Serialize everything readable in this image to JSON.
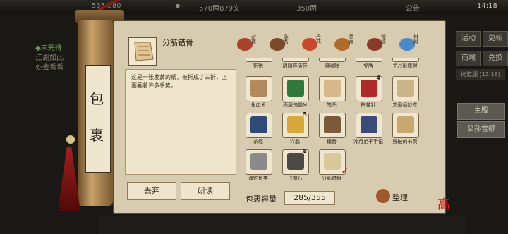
{
  "hud": {
    "resource1": "535/280",
    "currency": "570两879文",
    "gold": "350两",
    "announcement": "公告",
    "clock": "14:18"
  },
  "quest": {
    "header": "未完待",
    "line2": "江湖如此",
    "line3": "处去看看"
  },
  "right_menu": {
    "btn1": "活动",
    "btn2": "更新",
    "btn3": "商城",
    "btn4": "兑换",
    "label": "拘道服 (13:16)",
    "btn5": "主殿",
    "btn6": "公孙雪柳"
  },
  "scroll": {
    "label_top": "包",
    "label_bottom": "裹"
  },
  "selected_item": {
    "name": "分筋错骨",
    "description": "这是一张发黄的纸，被折成了三折，上面画着许多手势。"
  },
  "actions": {
    "discard": "丢弃",
    "study": "研读"
  },
  "categories": [
    {
      "label": "杂项",
      "color": "#a8442a"
    },
    {
      "label": "装备",
      "color": "#7a4a2a"
    },
    {
      "label": "丹药",
      "color": "#c84a2a"
    },
    {
      "label": "酒食",
      "color": "#b06a2a"
    },
    {
      "label": "秘籍",
      "color": "#8a3a2a"
    },
    {
      "label": "材料",
      "color": "#4a8ac8"
    }
  ],
  "items_partial": [
    {
      "name": "铜镜",
      "color": "#6b6255"
    },
    {
      "name": "阴阳阵法符",
      "color": "#6b5a3a"
    },
    {
      "name": "琉璃镜",
      "color": "#4a7a8a"
    },
    {
      "name": "令牌",
      "color": "#6b5a3a"
    },
    {
      "name": "半月形腰牌",
      "color": "#5f5a52"
    }
  ],
  "items": [
    {
      "name": "化血术",
      "count": "",
      "color": "#b08a5a",
      "icon": "scroll-icon"
    },
    {
      "name": "丙型傀儡M",
      "count": "",
      "color": "#2f7a3a",
      "icon": "puppet-icon"
    },
    {
      "name": "笔杀",
      "count": "",
      "color": "#d8b88a",
      "icon": "paper-icon"
    },
    {
      "name": "梅花针",
      "count": "4",
      "color": "#b02a2a",
      "icon": "needle-icon"
    },
    {
      "name": "文盈经抄本",
      "count": "",
      "color": "#cbb48a",
      "icon": "page-icon"
    },
    {
      "name": "茶经",
      "count": "",
      "color": "#2f4a7a",
      "icon": "book-icon"
    },
    {
      "name": "介晶",
      "count": "5",
      "color": "#d8a83a",
      "icon": "crystal-icon"
    },
    {
      "name": "檀香",
      "count": "",
      "color": "#7a5a3a",
      "icon": "incense-icon"
    },
    {
      "name": "泠月弟子手记",
      "count": "",
      "color": "#3a4a7a",
      "icon": "book-icon"
    },
    {
      "name": "残破的书页",
      "count": "",
      "color": "#c8a870",
      "icon": "page-icon"
    },
    {
      "name": "海钓鱼竿",
      "count": "",
      "color": "#8a8a8a",
      "icon": "rod-icon"
    },
    {
      "name": "飞蝗石",
      "count": "8",
      "color": "#4a4a48",
      "icon": "stone-icon"
    },
    {
      "name": "分筋错骨",
      "count": "",
      "color": "#d8c89a",
      "icon": "page-icon"
    }
  ],
  "capacity": {
    "label": "包裹容量",
    "value": "285/355"
  },
  "sort_label": "整理",
  "corner_mark": "高"
}
